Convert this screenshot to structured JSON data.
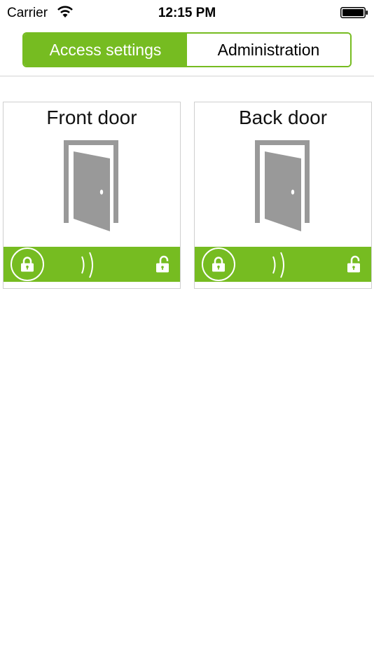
{
  "status_bar": {
    "carrier": "Carrier",
    "time": "12:15 PM"
  },
  "tabs": [
    {
      "label": "Access settings",
      "selected": true
    },
    {
      "label": "Administration",
      "selected": false
    }
  ],
  "doors": [
    {
      "name": "Front door"
    },
    {
      "name": "Back door"
    }
  ],
  "icons": {
    "wifi": "wifi-icon",
    "battery": "battery-icon",
    "door": "open-door-icon",
    "lock": "lock-icon",
    "signal": "wireless-signal-icon",
    "unlock": "unlock-icon"
  },
  "colors": {
    "accent": "#76bc21",
    "door_gray": "#999999",
    "card_border": "#cfcfcf"
  }
}
